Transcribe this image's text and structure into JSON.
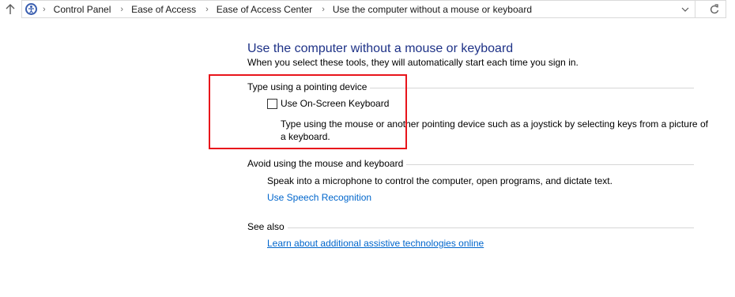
{
  "address_bar": {
    "breadcrumbs": [
      "Control Panel",
      "Ease of Access",
      "Ease of Access Center",
      "Use the computer without a mouse or keyboard"
    ]
  },
  "page": {
    "title": "Use the computer without a mouse or keyboard",
    "subtitle": "When you select these tools, they will automatically start each time you sign in."
  },
  "sections": {
    "pointing": {
      "header": "Type using a pointing device",
      "checkbox_label": "Use On-Screen Keyboard",
      "checked": false,
      "description_line1": "Type using the mouse or another pointing device such as a joystick by selecting keys from a picture of",
      "description_line2": "a keyboard."
    },
    "avoid": {
      "header": "Avoid using the mouse and keyboard",
      "description": "Speak into a microphone to control the computer, open programs, and dictate text.",
      "link": "Use Speech Recognition"
    },
    "see_also": {
      "header": "See also",
      "link": "Learn about additional assistive technologies online"
    }
  },
  "colors": {
    "title": "#1e3287",
    "link": "#0066cc",
    "highlight": "#e8141b"
  },
  "icons": {
    "up": "arrow-up-icon",
    "location": "control-panel-icon",
    "separator": "chevron-right-icon",
    "dropdown": "chevron-down-icon",
    "refresh": "refresh-icon"
  }
}
